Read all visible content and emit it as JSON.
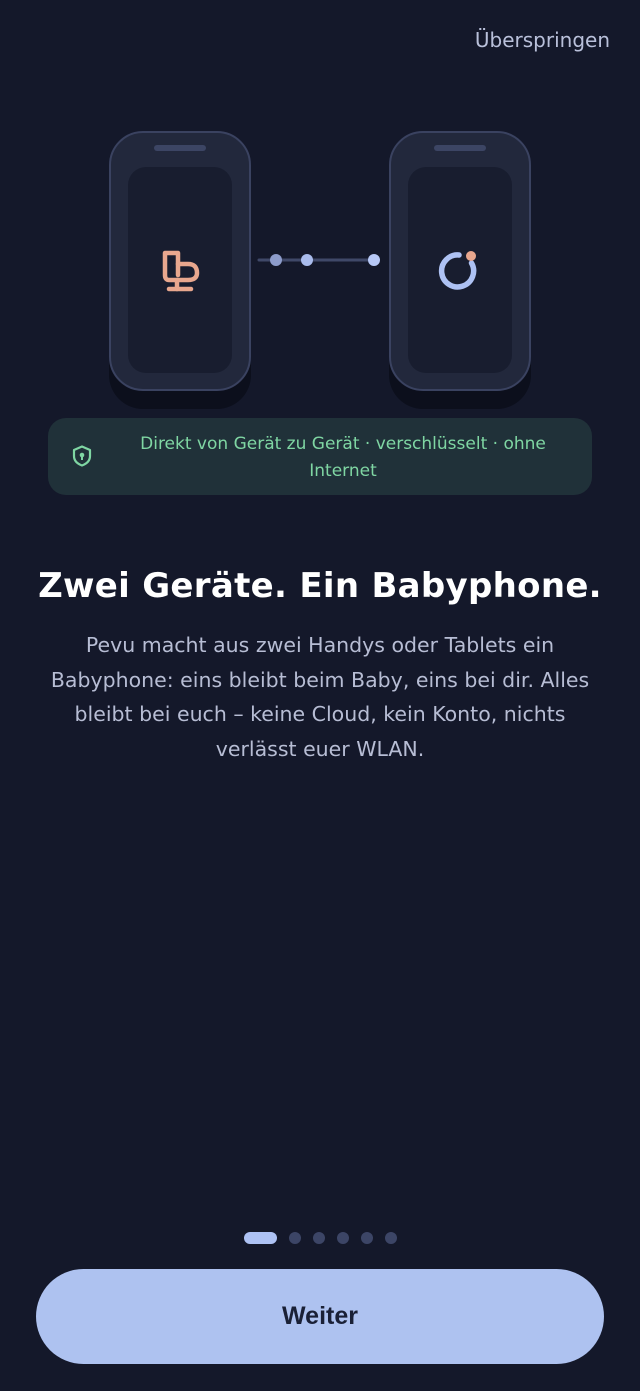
{
  "header": {
    "skip_label": "Überspringen"
  },
  "illustration": {
    "left_device_icon": "baby-crib-icon",
    "right_device_icon": "parent-monitor-icon",
    "connection_icon": "connection-dots-icon"
  },
  "badge": {
    "icon": "shield-lock-icon",
    "text": "Direkt von Gerät zu Gerät · verschlüsselt · ohne Internet"
  },
  "content": {
    "title": "Zwei Geräte. Ein Babyphone.",
    "description": "Pevu macht aus zwei Handys oder Tablets ein Babyphone: eins bleibt beim Baby, eins bei dir. Alles bleibt bei euch – keine Cloud, kein Konto, nichts verlässt euer WLAN."
  },
  "pagination": {
    "total": 6,
    "current": 1
  },
  "footer": {
    "continue_label": "Weiter"
  },
  "colors": {
    "background": "#14182a",
    "accent": "#aec2f0",
    "badge_text": "#7fd6a3",
    "crib_icon": "#e8a78e",
    "monitor_icon": "#aec2f4",
    "monitor_dot": "#e8a78e"
  }
}
